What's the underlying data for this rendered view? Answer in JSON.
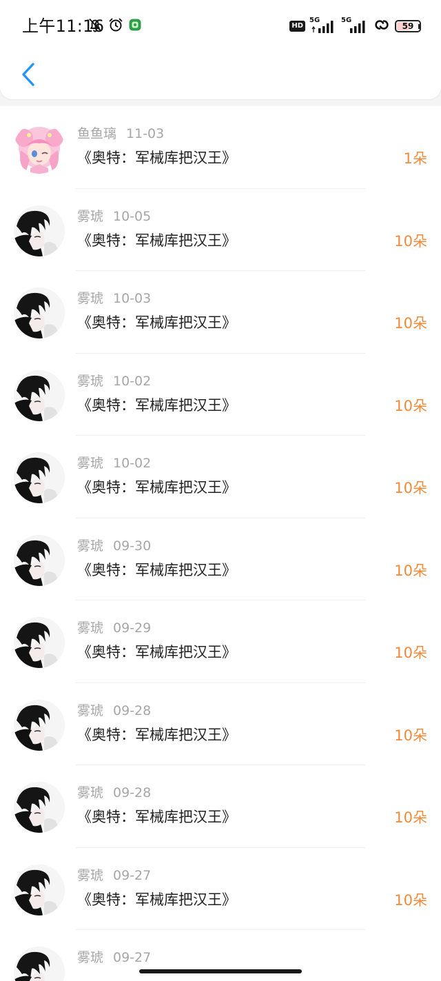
{
  "status_bar": {
    "time": "上午11:16",
    "hd": "HD",
    "sim1": "5G",
    "sim2": "5G",
    "battery": "59",
    "battery_level": 0.59,
    "icons": [
      "bell-off-icon",
      "alarm-icon",
      "app-notification-icon",
      "hd-icon",
      "signal-5g-icon",
      "signal-5g-icon",
      "link-icon",
      "battery-icon"
    ]
  },
  "header": {
    "back_icon": "chevron-left-icon",
    "accent": "#2196f3"
  },
  "colors": {
    "amount": "#f28a3a",
    "meta": "#a6a6a6",
    "title": "#222222"
  },
  "items": [
    {
      "user": "鱼鱼璃",
      "date": "11-03",
      "title": "《奥特：军械库把汉王》",
      "amount": "1朵",
      "avatar": "pink-anime-girl-avatar"
    },
    {
      "user": "雾琥",
      "date": "10-05",
      "title": "《奥特：军械库把汉王》",
      "amount": "10朵",
      "avatar": "dark-hair-boy-avatar"
    },
    {
      "user": "雾琥",
      "date": "10-03",
      "title": "《奥特：军械库把汉王》",
      "amount": "10朵",
      "avatar": "dark-hair-boy-avatar"
    },
    {
      "user": "雾琥",
      "date": "10-02",
      "title": "《奥特：军械库把汉王》",
      "amount": "10朵",
      "avatar": "dark-hair-boy-avatar"
    },
    {
      "user": "雾琥",
      "date": "10-02",
      "title": "《奥特：军械库把汉王》",
      "amount": "10朵",
      "avatar": "dark-hair-boy-avatar"
    },
    {
      "user": "雾琥",
      "date": "09-30",
      "title": "《奥特：军械库把汉王》",
      "amount": "10朵",
      "avatar": "dark-hair-boy-avatar"
    },
    {
      "user": "雾琥",
      "date": "09-29",
      "title": "《奥特：军械库把汉王》",
      "amount": "10朵",
      "avatar": "dark-hair-boy-avatar"
    },
    {
      "user": "雾琥",
      "date": "09-28",
      "title": "《奥特：军械库把汉王》",
      "amount": "10朵",
      "avatar": "dark-hair-boy-avatar"
    },
    {
      "user": "雾琥",
      "date": "09-28",
      "title": "《奥特：军械库把汉王》",
      "amount": "10朵",
      "avatar": "dark-hair-boy-avatar"
    },
    {
      "user": "雾琥",
      "date": "09-27",
      "title": "《奥特：军械库把汉王》",
      "amount": "10朵",
      "avatar": "dark-hair-boy-avatar"
    },
    {
      "user": "雾琥",
      "date": "09-27",
      "title": "",
      "amount": "",
      "avatar": "dark-hair-boy-avatar"
    }
  ]
}
